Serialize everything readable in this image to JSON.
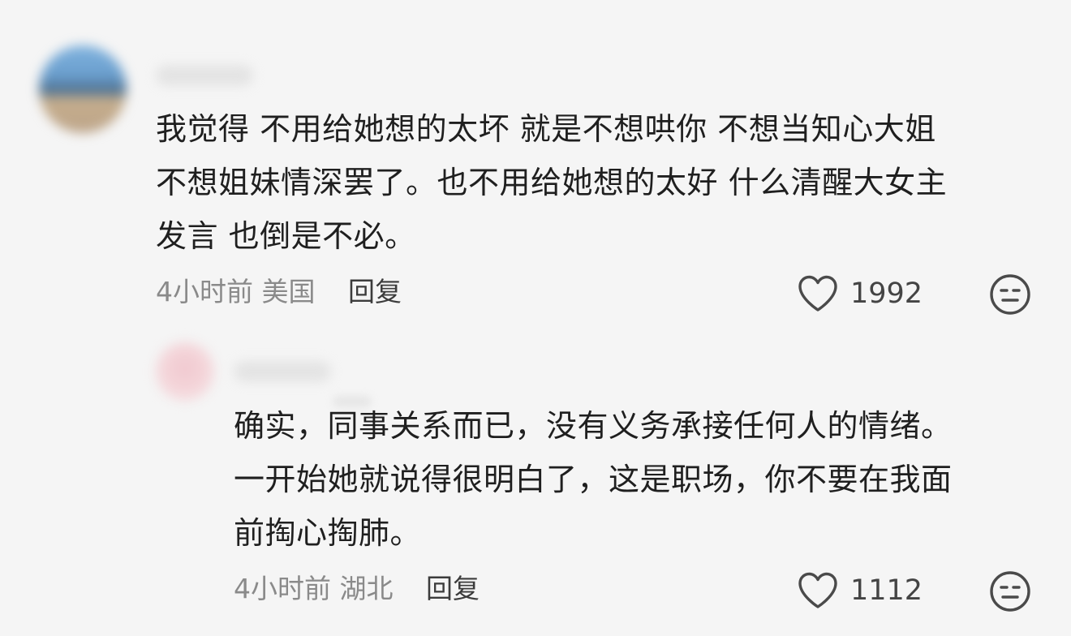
{
  "comments": [
    {
      "text_lines": [
        "我觉得 不用给她想的太坏 就是不想哄你 不想当知心大姐",
        "不想姐妹情深罢了。也不用给她想的太好 什么清醒大女主",
        "发言 也倒是不必。"
      ],
      "time": "4小时前",
      "location": "美国",
      "reply_label": "回复",
      "like_count": "1992"
    },
    {
      "text_lines": [
        "确实，同事关系而已，没有义务承接任何人的情绪。",
        "一开始她就说得很明白了，这是职场，你不要在我面",
        "前掏心掏肺。"
      ],
      "time": "4小时前",
      "location": "湖北",
      "reply_label": "回复",
      "like_count": "1112"
    }
  ],
  "icons": {
    "like": "heart-outline-icon",
    "reaction": "neutral-face-icon"
  },
  "colors": {
    "background": "#f5f5f5",
    "text": "#1f1f1f",
    "meta": "#8a8a8a"
  }
}
